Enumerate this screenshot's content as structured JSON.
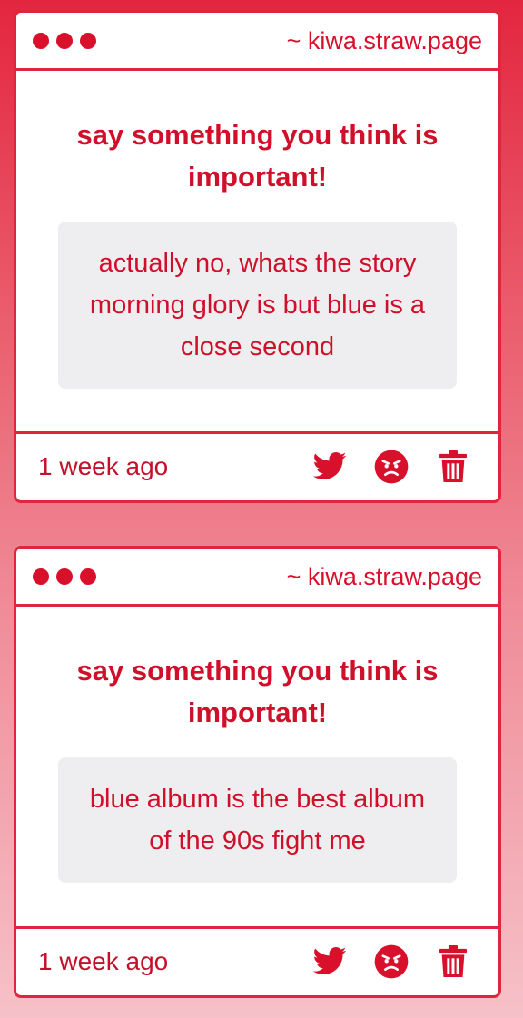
{
  "posts": [
    {
      "site": "~ kiwa.straw.page",
      "question": "say something you think is important!",
      "answer": "actually no, whats the story morning glory is but blue is a close second",
      "time": "1 week ago",
      "icons": [
        "twitter-icon",
        "angry-face-icon",
        "trash-icon"
      ]
    },
    {
      "site": "~ kiwa.straw.page",
      "question": "say something you think is important!",
      "answer": "blue album is the best album of the 90s fight me",
      "time": "1 week ago",
      "icons": [
        "twitter-icon",
        "angry-face-icon",
        "trash-icon"
      ]
    }
  ],
  "colors": {
    "accent": "#d8102b",
    "answer_bg": "#eeedef",
    "page_top": "#e3263f",
    "page_bottom": "#f6c1c8"
  }
}
